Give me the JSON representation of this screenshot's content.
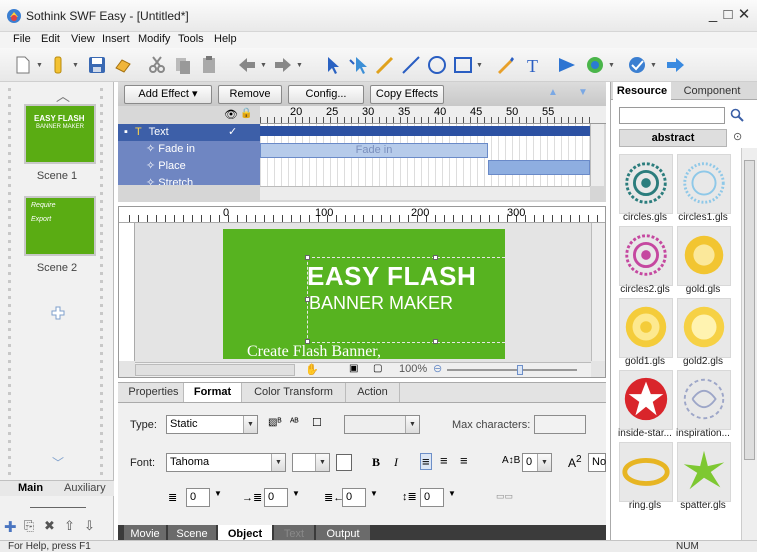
{
  "window": {
    "title": "Sothink SWF Easy - [Untitled*]"
  },
  "menu": [
    "File",
    "Edit",
    "View",
    "Insert",
    "Modify",
    "Tools",
    "Help"
  ],
  "scenes": {
    "items": [
      {
        "label": "Scene 1",
        "thumb_title": "EASY FLASH",
        "thumb_sub": "BANNER MAKER"
      },
      {
        "label": "Scene 2",
        "thumb_title": "Require",
        "thumb_sub": "Export"
      }
    ],
    "tabs": [
      "Main",
      "Auxiliary"
    ]
  },
  "timeline": {
    "buttons": {
      "add_effect": "Add Effect",
      "remove": "Remove",
      "config": "Config...",
      "copy_effects": "Copy Effects"
    },
    "ruler": [
      "20",
      "25",
      "30",
      "35",
      "40",
      "45",
      "50",
      "55"
    ],
    "layers": [
      {
        "name": "Text"
      },
      {
        "name": "Fade in"
      },
      {
        "name": "Place"
      },
      {
        "name": "Stretch"
      }
    ],
    "bar_label": "Fade in"
  },
  "stage": {
    "ruler": [
      "0",
      "100",
      "200",
      "300"
    ],
    "banner": {
      "title": "EASY FLASH",
      "subtitle": "BANNER MAKER",
      "tagline": "Create Flash Banner,"
    },
    "zoom": "100%"
  },
  "properties": {
    "tabs": [
      "Properties",
      "Format",
      "Color Transform",
      "Action"
    ],
    "active_tab": "Format",
    "type_label": "Type:",
    "type_value": "Static",
    "maxchars_label": "Max characters:",
    "font_label": "Font:",
    "font_value": "Tahoma",
    "font_size": "0",
    "bold": "B",
    "italic": "I",
    "superscript": "A",
    "no_label": "No",
    "spacing": [
      "0",
      "0",
      "0",
      "0"
    ],
    "bottom_tabs": [
      "Movie",
      "Scene",
      "Object",
      "Text",
      "Output"
    ],
    "active_bottom_tab": "Object"
  },
  "resource": {
    "tabs": [
      "Resource",
      "Component"
    ],
    "active_tab": "Resource",
    "category": "abstract",
    "items": [
      {
        "label": "circles.gls",
        "icon": "circles-teal"
      },
      {
        "label": "circles1.gls",
        "icon": "circles-lightblue"
      },
      {
        "label": "circles2.gls",
        "icon": "circles-pink"
      },
      {
        "label": "gold.gls",
        "icon": "gold-ring"
      },
      {
        "label": "gold1.gls",
        "icon": "gold-coin"
      },
      {
        "label": "gold2.gls",
        "icon": "gold-coin-2"
      },
      {
        "label": "inside-star...",
        "icon": "red-star"
      },
      {
        "label": "inspiration...",
        "icon": "swirl"
      },
      {
        "label": "ring.gls",
        "icon": "ring"
      },
      {
        "label": "spatter.gls",
        "icon": "spatter"
      }
    ]
  },
  "status": {
    "left": "For Help, press F1",
    "right": "NUM"
  },
  "colors": {
    "accent": "#4a6fb5",
    "stage_green": "#57b320",
    "layer_row": "#7b8fc4"
  }
}
